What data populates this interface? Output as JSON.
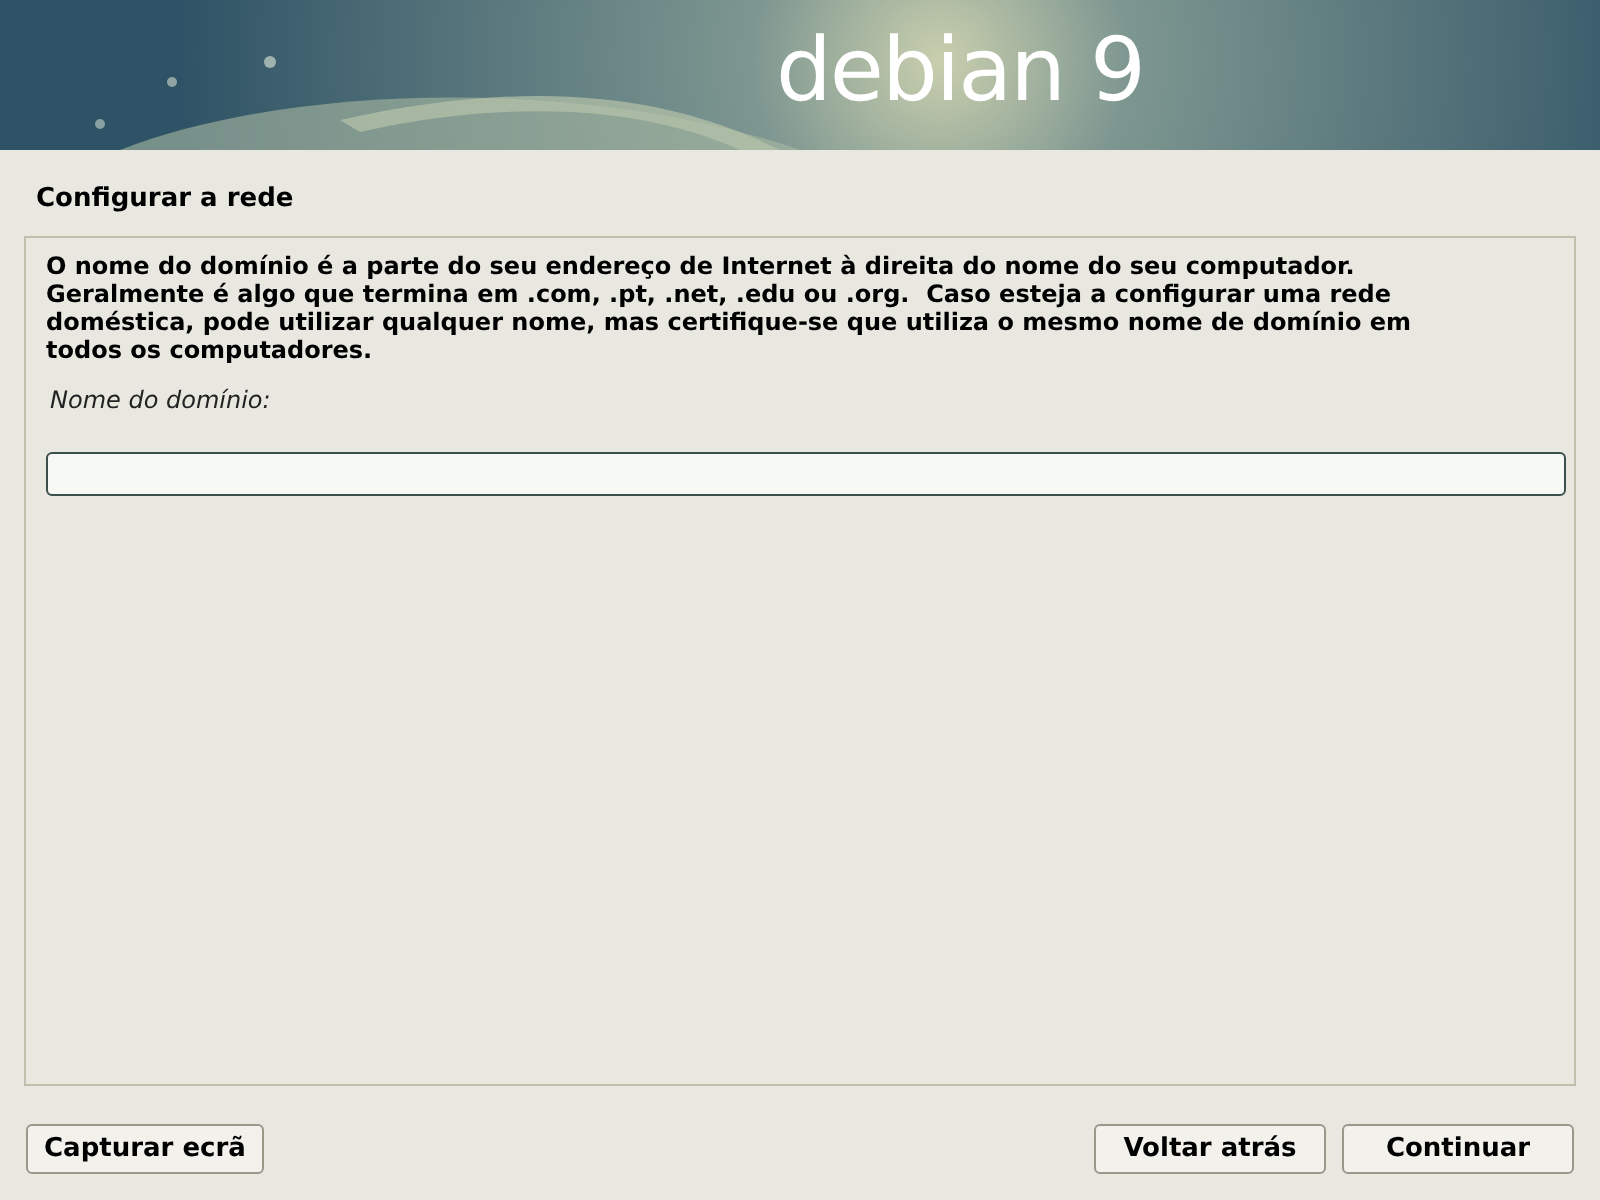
{
  "banner": {
    "logo": "debian 9"
  },
  "title": "Configurar a rede",
  "description": "O nome do domínio é a parte do seu endereço de Internet à direita do nome do seu computador.\nGeralmente é algo que termina em .com, .pt, .net, .edu ou .org.  Caso esteja a configurar uma rede\ndoméstica, pode utilizar qualquer nome, mas certifique-se que utiliza o mesmo nome de domínio em\ntodos os computadores.",
  "field": {
    "label": "Nome do domínio:"
  },
  "buttons": [
    {
      "label": "Capturar ecrã",
      "kind": "left"
    },
    {
      "label": "Voltar atrás",
      "kind": "right"
    },
    {
      "label": "Continuar",
      "kind": "right"
    }
  ]
}
